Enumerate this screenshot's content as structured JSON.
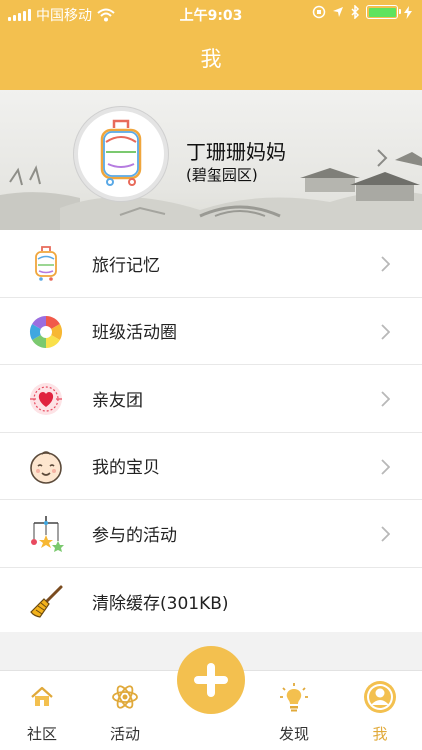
{
  "status_bar": {
    "carrier": "中国移动",
    "time": "上午9:03"
  },
  "header": {
    "title": "我"
  },
  "profile": {
    "name": "丁珊珊妈妈",
    "area": "(碧玺园区)"
  },
  "menu": [
    {
      "label": "旅行记忆",
      "icon": "suitcase-icon"
    },
    {
      "label": "班级活动圈",
      "icon": "aperture-icon"
    },
    {
      "label": "亲友团",
      "icon": "heart-stamp-icon"
    },
    {
      "label": "我的宝贝",
      "icon": "baby-face-icon"
    },
    {
      "label": "参与的活动",
      "icon": "baby-mobile-icon"
    },
    {
      "label": "清除缓存(301KB)",
      "icon": "broom-icon"
    }
  ],
  "tabbar": {
    "items": [
      {
        "label": "社区",
        "icon": "house-icon"
      },
      {
        "label": "活动",
        "icon": "atom-icon"
      },
      {
        "label": "发现",
        "icon": "lightbulb-icon"
      },
      {
        "label": "我",
        "icon": "user-icon"
      }
    ],
    "active": "我",
    "center_action": "plus-icon"
  },
  "colors": {
    "accent": "#f3c04f",
    "active_tab": "#e0a93a",
    "background": "#f2f2f2"
  }
}
